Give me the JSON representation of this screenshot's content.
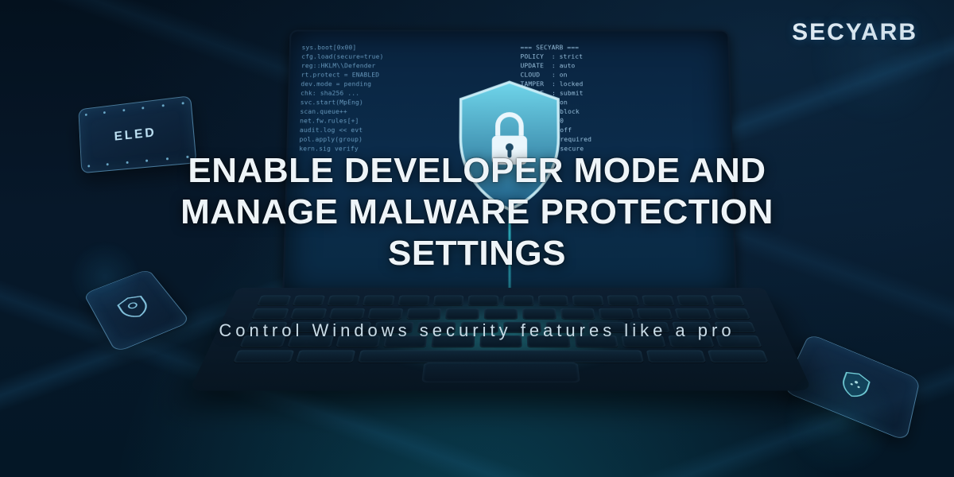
{
  "brand": "SECYARB",
  "headline": "ENABLE DEVELOPER MODE AND MANAGE MALWARE PROTECTION SETTINGS",
  "subheadline": "Control Windows security features like a pro",
  "chips": {
    "eled_label": "ELED"
  },
  "colors": {
    "bg_deep": "#04111e",
    "accent_cyan": "#3ce6f0",
    "text_primary": "#eef4f8",
    "text_secondary": "#c9dbe6"
  }
}
